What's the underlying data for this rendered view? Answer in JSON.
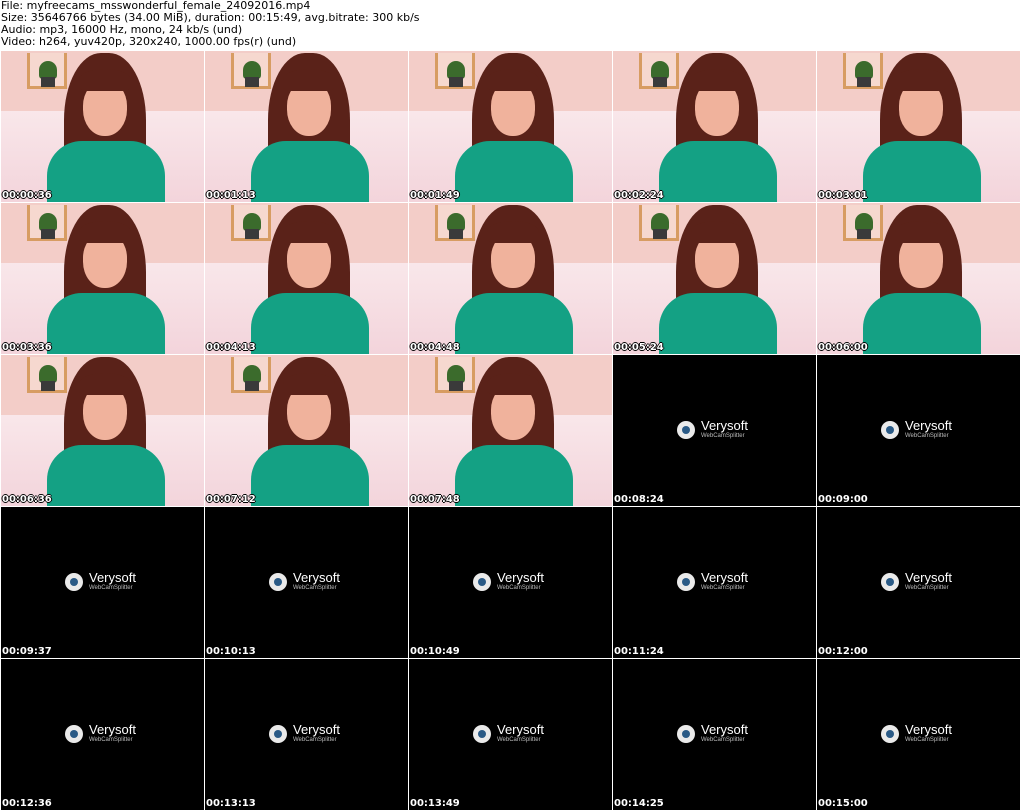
{
  "header": {
    "file_line": "File: myfreecams_msswonderful_female_24092016.mp4",
    "size_line": "Size: 35646766 bytes (34.00 MiB), duration: 00:15:49, avg.bitrate: 300 kb/s",
    "audio_line": "Audio: mp3, 16000 Hz, mono, 24 kb/s (und)",
    "video_line": "Video: h264, yuv420p, 320x240, 1000.00 fps(r) (und)"
  },
  "logo": {
    "name": "Verysoft",
    "sub": "WebCamSplitter"
  },
  "thumbnails": [
    {
      "time": "00:00:36",
      "type": "cam"
    },
    {
      "time": "00:01:13",
      "type": "cam"
    },
    {
      "time": "00:01:49",
      "type": "cam"
    },
    {
      "time": "00:02:24",
      "type": "cam"
    },
    {
      "time": "00:03:01",
      "type": "cam"
    },
    {
      "time": "00:03:36",
      "type": "cam"
    },
    {
      "time": "00:04:13",
      "type": "cam"
    },
    {
      "time": "00:04:48",
      "type": "cam"
    },
    {
      "time": "00:05:24",
      "type": "cam"
    },
    {
      "time": "00:06:00",
      "type": "cam"
    },
    {
      "time": "00:06:36",
      "type": "cam"
    },
    {
      "time": "00:07:12",
      "type": "cam"
    },
    {
      "time": "00:07:48",
      "type": "cam"
    },
    {
      "time": "00:08:24",
      "type": "logo"
    },
    {
      "time": "00:09:00",
      "type": "logo"
    },
    {
      "time": "00:09:37",
      "type": "logo"
    },
    {
      "time": "00:10:13",
      "type": "logo"
    },
    {
      "time": "00:10:49",
      "type": "logo"
    },
    {
      "time": "00:11:24",
      "type": "logo"
    },
    {
      "time": "00:12:00",
      "type": "logo"
    },
    {
      "time": "00:12:36",
      "type": "logo"
    },
    {
      "time": "00:13:13",
      "type": "logo"
    },
    {
      "time": "00:13:49",
      "type": "logo"
    },
    {
      "time": "00:14:25",
      "type": "logo"
    },
    {
      "time": "00:15:00",
      "type": "logo"
    }
  ]
}
